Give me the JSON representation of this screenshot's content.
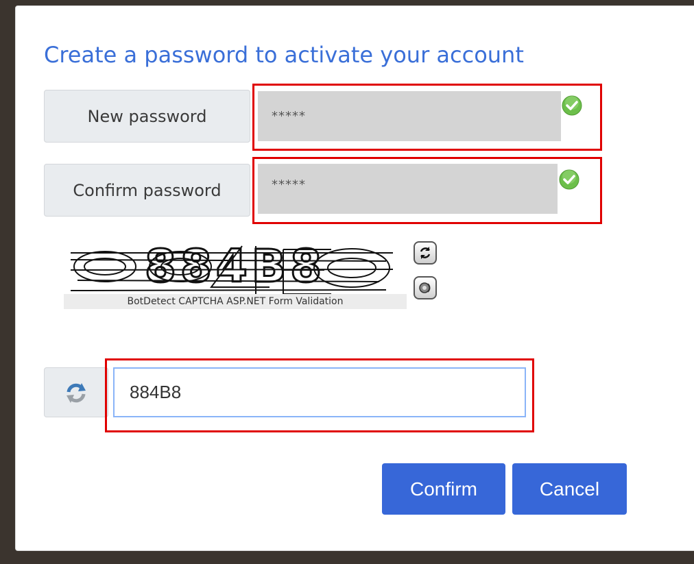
{
  "form": {
    "title": "Create a password to activate your account",
    "new_password": {
      "label": "New password",
      "value": "*****",
      "valid_icon": "check-circle-icon"
    },
    "confirm_password": {
      "label": "Confirm password",
      "value": "*****",
      "valid_icon": "check-circle-icon"
    },
    "captcha": {
      "image_text": "884B8",
      "caption": "BotDetect CAPTCHA ASP.NET Form Validation",
      "reload_icon": "refresh-icon",
      "sound_icon": "speaker-icon",
      "input_value": "884B8",
      "input_addon_icon": "refresh-icon"
    },
    "buttons": {
      "confirm_label": "Confirm",
      "cancel_label": "Cancel"
    }
  },
  "colors": {
    "title": "#3a6fd8",
    "button": "#3767d8",
    "highlight": "#e00000",
    "valid": "#6cbf4a"
  }
}
